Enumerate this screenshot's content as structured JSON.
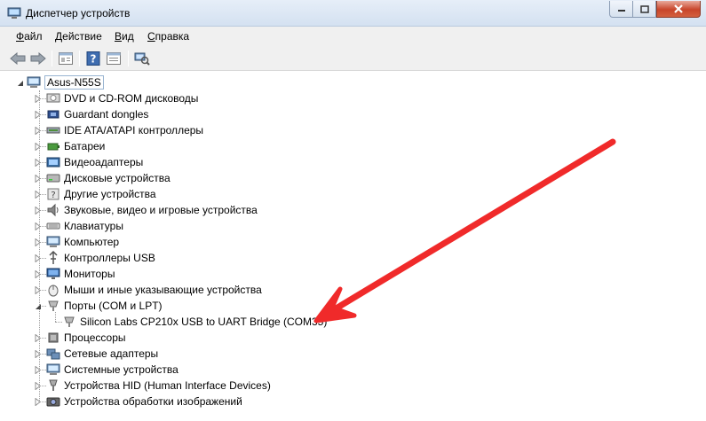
{
  "window": {
    "title": "Диспетчер устройств"
  },
  "menu": [
    {
      "label": "Файл",
      "key": "Ф",
      "rest": "айл"
    },
    {
      "label": "Действие",
      "key": "Д",
      "rest": "ействие"
    },
    {
      "label": "Вид",
      "key": "В",
      "rest": "ид"
    },
    {
      "label": "Справка",
      "key": "С",
      "rest": "правка"
    }
  ],
  "toolbar": [
    "back-icon",
    "forward-icon",
    "properties-icon",
    "help-icon",
    "show-hidden-icon",
    "scan-hardware-icon"
  ],
  "tree": {
    "root": "Asus-N55S",
    "categories": [
      "DVD и CD-ROM дисководы",
      "Guardant dongles",
      "IDE ATA/ATAPI контроллеры",
      "Батареи",
      "Видеоадаптеры",
      "Дисковые устройства",
      "Другие устройства",
      "Звуковые, видео и игровые устройства",
      "Клавиатуры",
      "Компьютер",
      "Контроллеры USB",
      "Мониторы",
      "Мыши и иные указывающие устройства",
      "Порты (COM и LPT)",
      "Процессоры",
      "Сетевые адаптеры",
      "Системные устройства",
      "Устройства HID (Human Interface Devices)",
      "Устройства обработки изображений"
    ],
    "expanded_child": "Silicon Labs CP210x USB to UART Bridge (COM35)"
  },
  "colors": {
    "arrow": "#f02a2a",
    "accent": "#99b4d1"
  }
}
